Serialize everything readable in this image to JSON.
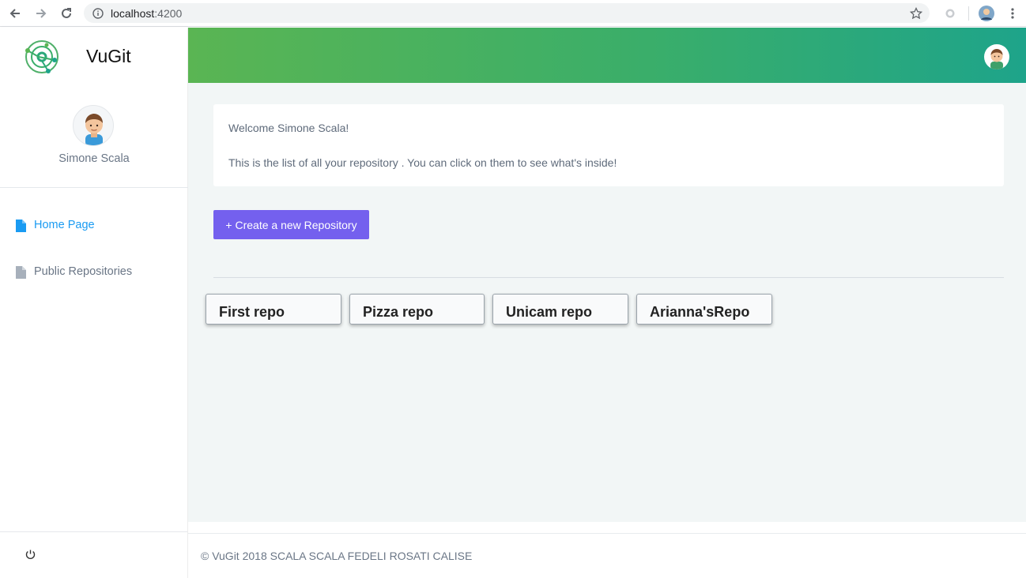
{
  "browser": {
    "url_host": "localhost",
    "url_port": ":4200",
    "icons": [
      "back-arrow-icon",
      "forward-arrow-icon",
      "reload-icon",
      "info-icon",
      "star-icon",
      "extension-icon",
      "user-avatar-icon",
      "menu-dots-icon"
    ]
  },
  "app": {
    "brand_name": "VuGit",
    "user_name": "Simone Scala"
  },
  "sidebar": {
    "items": [
      {
        "label": "Home Page",
        "icon": "file-icon",
        "active": true
      },
      {
        "label": "Public Repositories",
        "icon": "file-icon",
        "active": false
      }
    ]
  },
  "welcome": {
    "greeting": "Welcome Simone Scala!",
    "description": "This is the list of all your repository . You can click on them to see what's inside!"
  },
  "actions": {
    "create_label": "+ Create a new Repository"
  },
  "repositories": [
    {
      "name": "First repo"
    },
    {
      "name": "Pizza repo"
    },
    {
      "name": "Unicam repo"
    },
    {
      "name": "Arianna'sRepo"
    }
  ],
  "footer": {
    "text": "© VuGit 2018 SCALA SCALA FEDELI ROSATI CALISE"
  },
  "colors": {
    "accent": "#7460ee",
    "active_link": "#1a9bf2",
    "header_gradient_start": "#5ab553",
    "header_gradient_end": "#1ea48a"
  }
}
